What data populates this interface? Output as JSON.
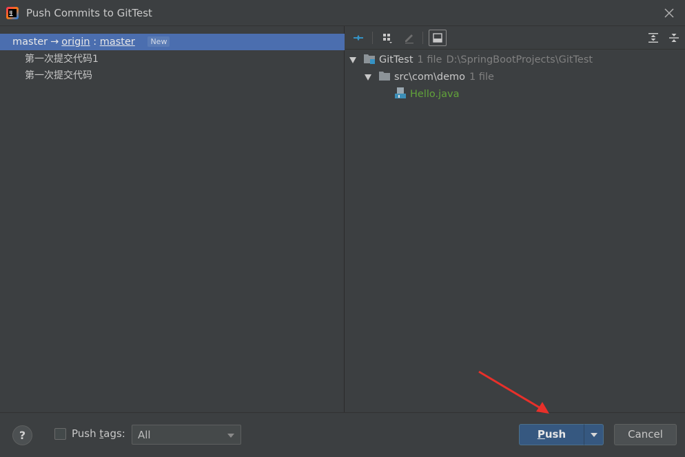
{
  "window": {
    "title": "Push Commits to GitTest"
  },
  "branch": {
    "local": "master",
    "arrow": "→",
    "remote": "origin",
    "separator": " : ",
    "remote_branch": "master",
    "badge": "New"
  },
  "commits": [
    {
      "message": "第一次提交代码1"
    },
    {
      "message": "第一次提交代码"
    }
  ],
  "tree": {
    "root": {
      "name": "GitTest",
      "count": "1 file",
      "path": "D:\\SpringBootProjects\\GitTest"
    },
    "folder": {
      "name": "src\\com\\demo",
      "count": "1 file"
    },
    "file": {
      "name": "Hello.java"
    }
  },
  "footer": {
    "help_label": "?",
    "push_tags_label_pre": "Push ",
    "push_tags_label_u": "t",
    "push_tags_label_post": "ags:",
    "push_tags_checked": false,
    "tags_select_value": "All",
    "push_label_u": "P",
    "push_label_rest": "ush",
    "cancel_label": "Cancel"
  },
  "colors": {
    "selection": "#4b6eaf",
    "java_file": "#62a33a",
    "primary_button": "#365880",
    "annotation_arrow": "#e8302a"
  }
}
